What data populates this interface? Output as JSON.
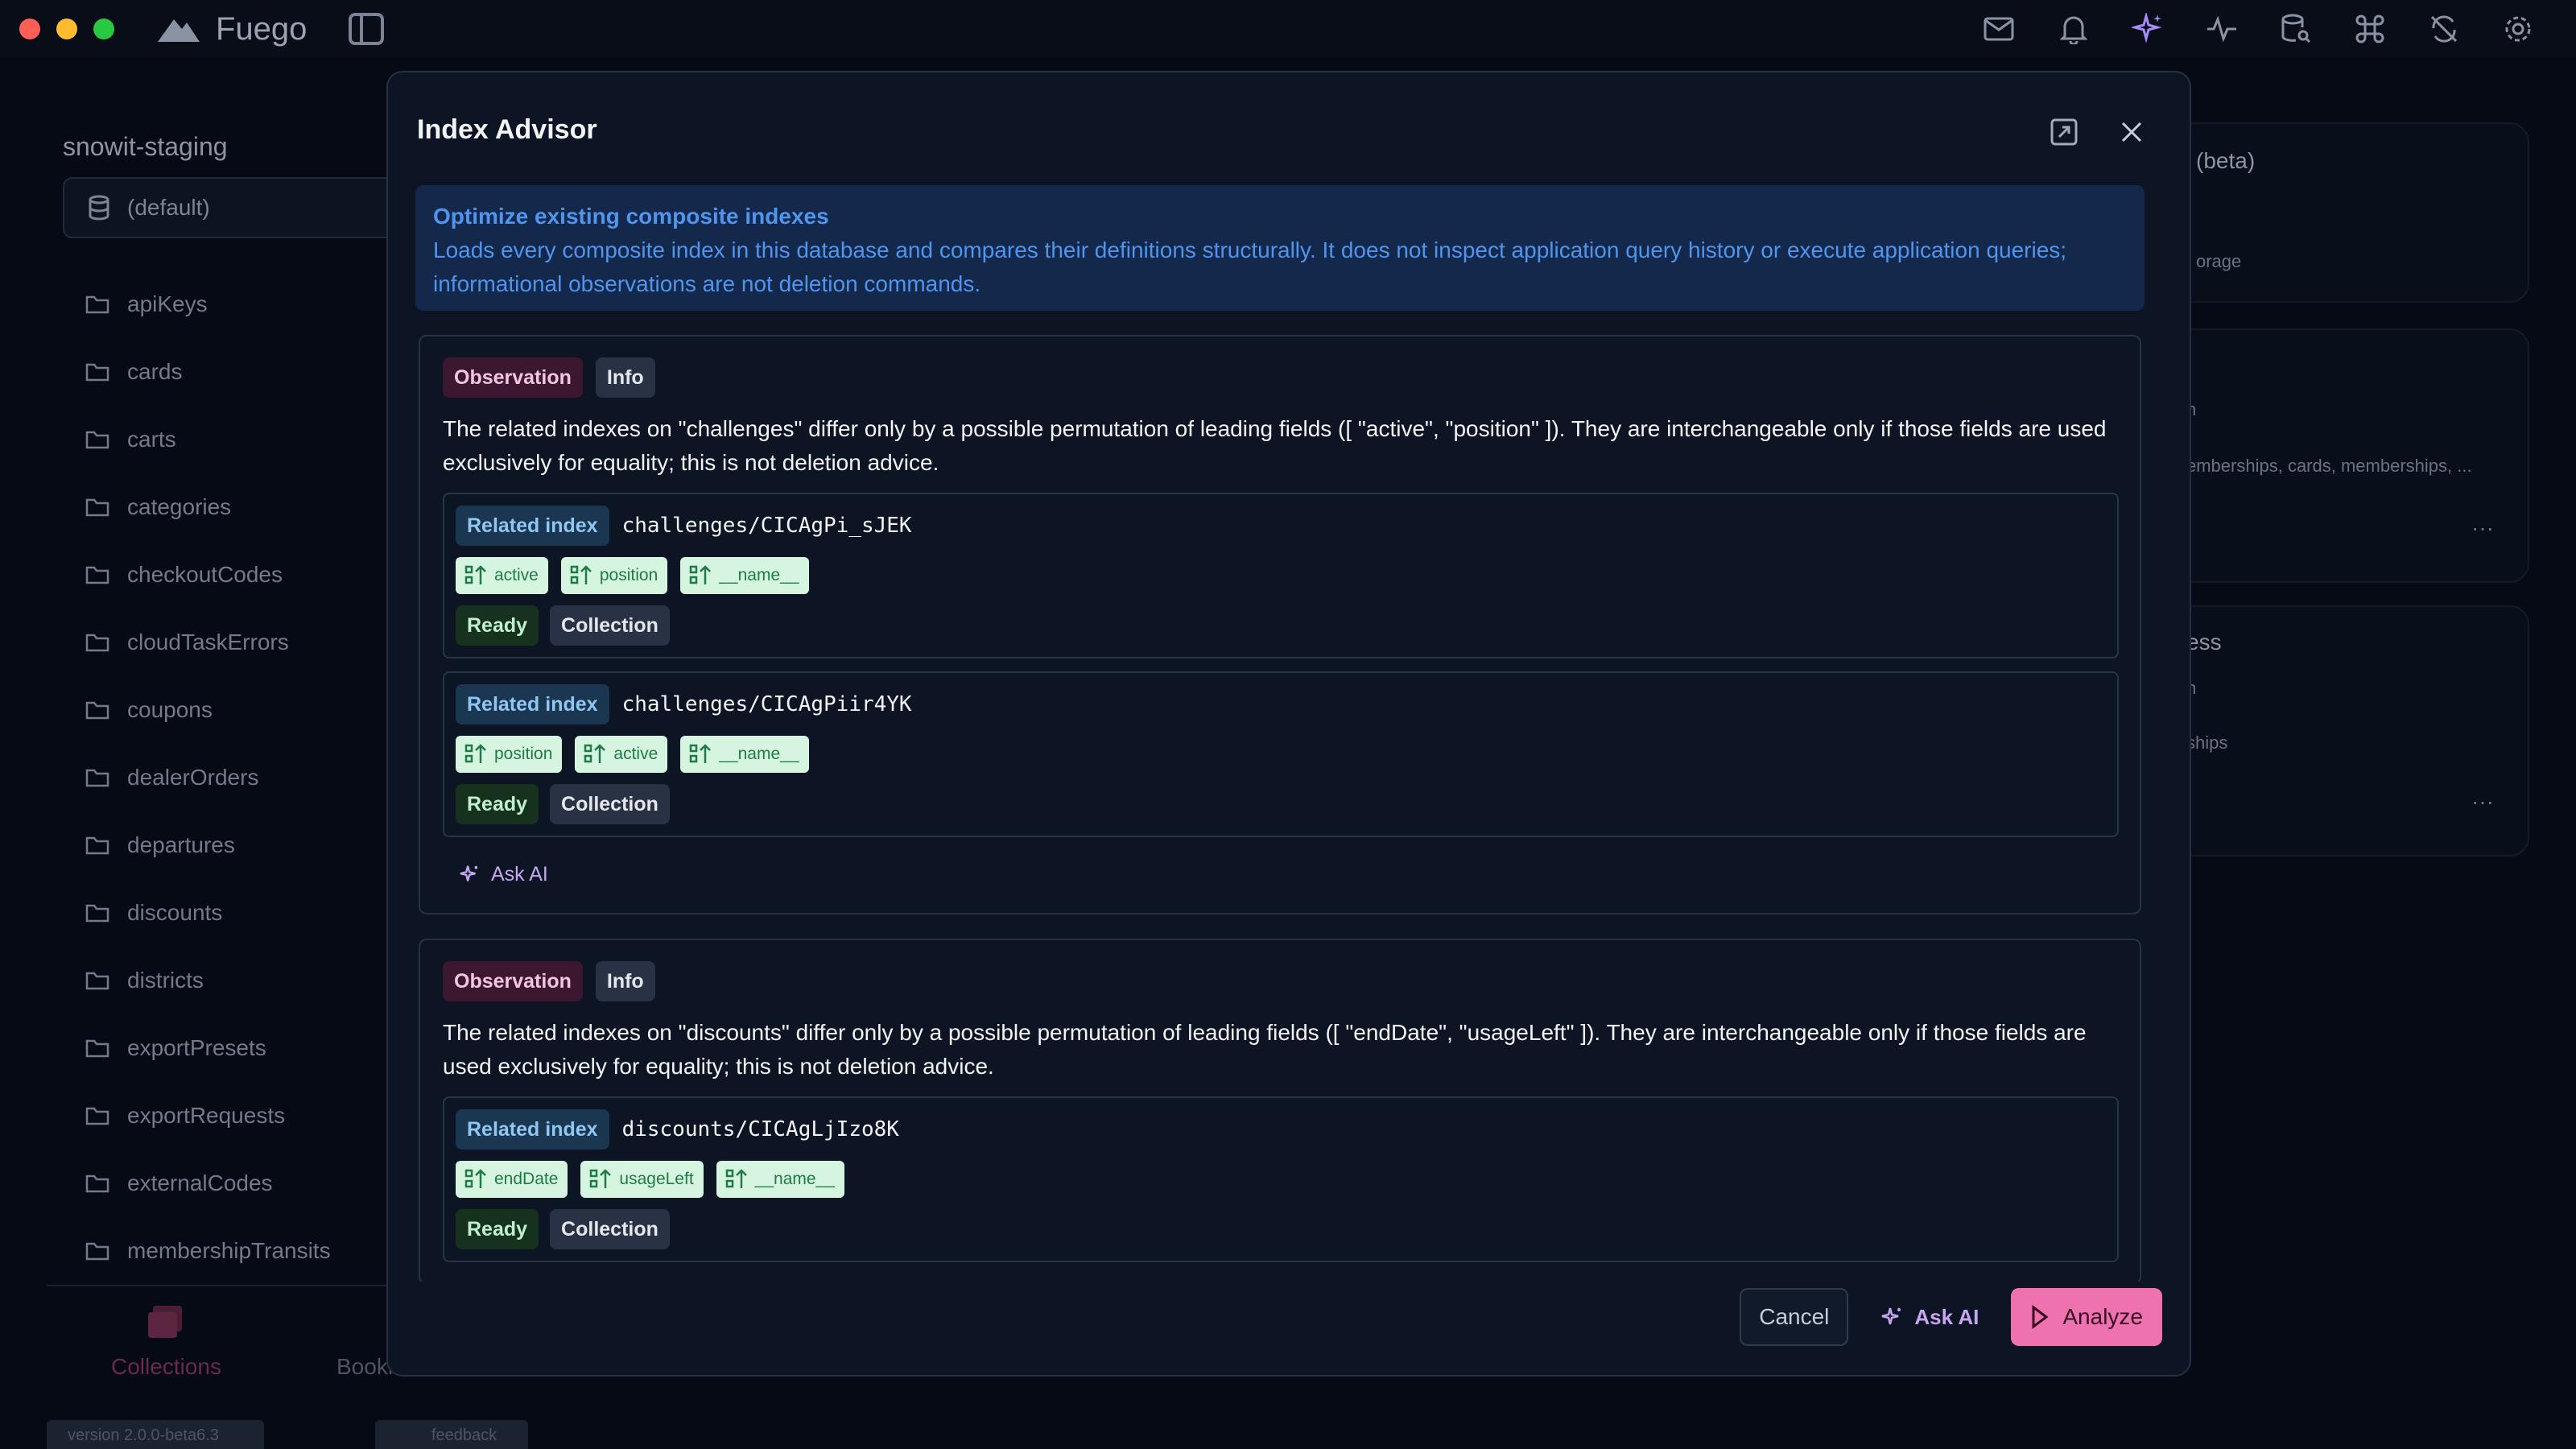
{
  "app": {
    "name": "Fuego",
    "project": "snowit-staging",
    "database": "(default)"
  },
  "collections": [
    "apiKeys",
    "cards",
    "carts",
    "categories",
    "checkoutCodes",
    "cloudTaskErrors",
    "coupons",
    "dealerOrders",
    "departures",
    "discounts",
    "districts",
    "exportPresets",
    "exportRequests",
    "externalCodes",
    "membershipTransits"
  ],
  "bottom_tabs": {
    "collections": "Collections",
    "bookmarks": "Bookmarks"
  },
  "footer_info": {
    "version": "version 2.0.0-beta6.3",
    "feedback": "feedback"
  },
  "background": {
    "beta": "(beta)",
    "storage": "orage",
    "memberships": "emberships, cards, memberships, ...",
    "access": "ess",
    "ships": "ships",
    "more1": "···",
    "more2": "···",
    "n1": "n",
    "n2": "n"
  },
  "modal": {
    "title": "Index Advisor",
    "banner_title": "Optimize existing composite indexes",
    "banner_text": "Loads every composite index in this database and compares their definitions structurally. It does not inspect application query history or execute application queries; informational observations are not deletion commands.",
    "observations": [
      {
        "type": "Observation",
        "level": "Info",
        "text": "The related indexes on \"challenges\" differ only by a possible permutation of leading fields ([ \"active\", \"position\" ]). They are interchangeable only if those fields are used exclusively for equality; this is not deletion advice.",
        "indexes": [
          {
            "label": "Related index",
            "path": "challenges/CICAgPi_sJEK",
            "fields": [
              "active",
              "position",
              "__name__"
            ],
            "status": "Ready",
            "scope": "Collection"
          },
          {
            "label": "Related index",
            "path": "challenges/CICAgPiir4YK",
            "fields": [
              "position",
              "active",
              "__name__"
            ],
            "status": "Ready",
            "scope": "Collection"
          }
        ],
        "ask_ai": "Ask AI"
      },
      {
        "type": "Observation",
        "level": "Info",
        "text": "The related indexes on \"discounts\" differ only by a possible permutation of leading fields ([ \"endDate\", \"usageLeft\" ]). They are interchangeable only if those fields are used exclusively for equality; this is not deletion advice.",
        "indexes": [
          {
            "label": "Related index",
            "path": "discounts/CICAgLjIzo8K",
            "fields": [
              "endDate",
              "usageLeft",
              "__name__"
            ],
            "status": "Ready",
            "scope": "Collection"
          }
        ]
      }
    ],
    "buttons": {
      "cancel": "Cancel",
      "ask_ai": "Ask AI",
      "analyze": "Analyze"
    }
  },
  "colors": {
    "accent": "#ee72b0",
    "info_blue": "#4f95ee",
    "field_green": "#1f7a47",
    "ai_purple": "#c6a7ef"
  }
}
